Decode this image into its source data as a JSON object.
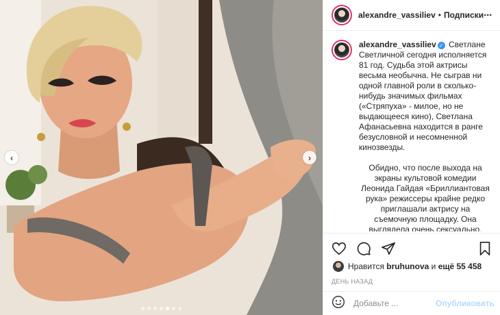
{
  "post": {
    "username": "alexandre_vassiliev",
    "separator": "•",
    "follow_label": "Подписки",
    "more_label": "···",
    "photo_alt": "photo",
    "carousel_total": 7,
    "carousel_current": 5
  },
  "caption": {
    "username": "alexandre_vassiliev",
    "paragraph1": "Светлане Светличной сегодня исполняется 81 год. Судьба этой актрисы весьма необычна.  Не сыграв ни одной главной роли в сколько-нибудь значимых фильмах («Стряпуха» - милое, но не выдающееся кино), Светлана Афанасьевна находится в ранге безусловной и несомненной кинозвезды.",
    "paragraph2": "Обидно, что после выхода на экраны культовой комедии Леонида Гайдая «Бриллиантовая рука» режиссеры крайне редко приглашали актрису на съемочную площадку. Она выглядела очень сексуально, чувственно, я бы сказал, порочно… Эти качества становились"
  },
  "likes": {
    "prefix": "Нравится",
    "user": "bruhunova",
    "middle": "и",
    "count_text": "ещё 55 458"
  },
  "timestamp": "ДЕНЬ НАЗАД",
  "comment": {
    "placeholder": "Добавьте ...",
    "publish_label": "Опубликовать"
  },
  "colors": {
    "accent": "#3897f0",
    "publish_disabled": "#b3dbff",
    "story_ring": "#e1306c"
  },
  "icons": [
    "heart-icon",
    "comment-icon",
    "share-icon",
    "bookmark-icon",
    "emoji-icon",
    "verified-icon",
    "chevron-left-icon",
    "chevron-right-icon"
  ]
}
